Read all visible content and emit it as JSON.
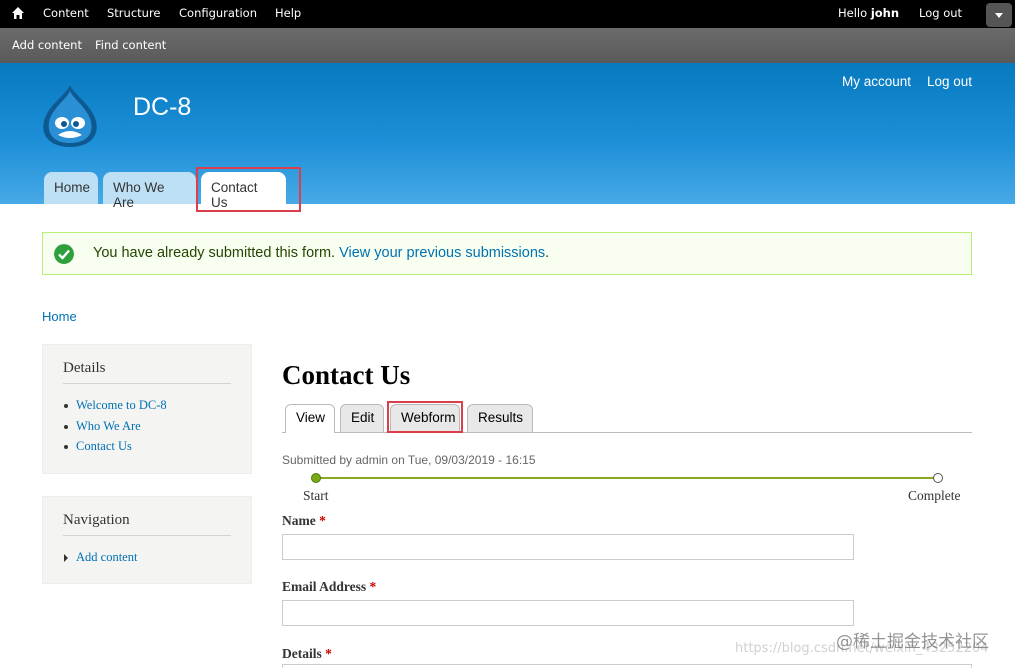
{
  "toolbar": {
    "menu": [
      "Content",
      "Structure",
      "Configuration",
      "Help"
    ],
    "hello": "Hello",
    "user": "john",
    "logout": "Log out"
  },
  "shortcuts": [
    "Add content",
    "Find content"
  ],
  "header": {
    "site_name": "DC-8",
    "secondary": [
      "My account",
      "Log out"
    ],
    "tabs": [
      "Home",
      "Who We Are",
      "Contact Us"
    ]
  },
  "message": {
    "text": "You have already submitted this form.",
    "link": "View your previous submissions",
    "end": "."
  },
  "breadcrumb": "Home",
  "sidebar": {
    "details": {
      "title": "Details",
      "items": [
        "Welcome to DC-8",
        "Who We Are",
        "Contact Us"
      ]
    },
    "navigation": {
      "title": "Navigation",
      "items": [
        "Add content"
      ]
    }
  },
  "main": {
    "title": "Contact Us",
    "tabs": [
      "View",
      "Edit",
      "Webform",
      "Results"
    ],
    "submitted": "Submitted by admin on Tue, 09/03/2019 - 16:15",
    "progress": {
      "start": "Start",
      "end": "Complete"
    },
    "fields": [
      {
        "label": "Name",
        "required": "*"
      },
      {
        "label": "Email Address",
        "required": "*"
      },
      {
        "label": "Details",
        "required": "*"
      }
    ]
  },
  "watermark": {
    "url": "https://blog.csdn.net/weixin_43252204",
    "cn": "@稀土掘金技术社区"
  },
  "colors": {
    "toolbar": "#000000",
    "header": "#0779bf",
    "link": "#0071b3",
    "highlight": "#dc3f4c"
  }
}
